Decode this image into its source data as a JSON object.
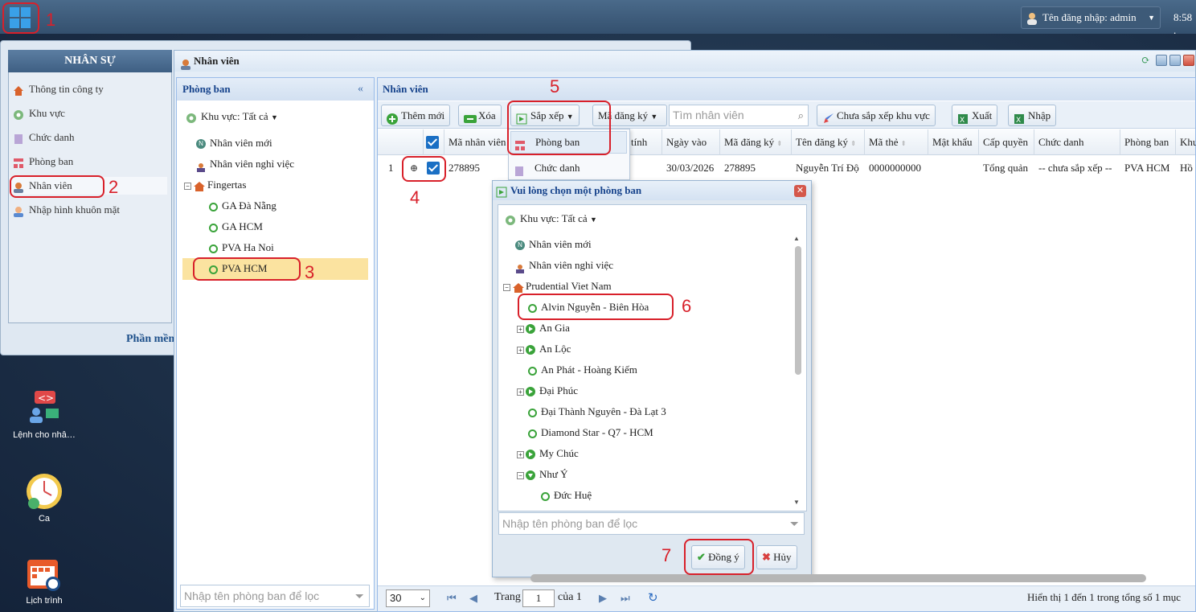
{
  "taskbar": {
    "user_label": "Tên đăng nhập: admin",
    "clock": "8:58 ."
  },
  "start_menu": {
    "title": "NHÂN SỰ",
    "items": [
      "Thông tin công ty",
      "Khu vực",
      "Chức danh",
      "Phòng ban",
      "Nhân viên",
      "Nhập hình khuôn mặt"
    ],
    "footer": "Phần mềm"
  },
  "desktop": {
    "icons": [
      "Lệnh cho nhâ…",
      "Ca",
      "Lịch trình"
    ]
  },
  "window": {
    "title": "Nhân viên"
  },
  "phong_ban": {
    "header": "Phòng ban",
    "region_filter": "Khu vực: Tất cả",
    "tree": [
      "Nhân viên mới",
      "Nhân viên nghỉ việc",
      "Fingertas",
      "GA Đà Nẵng",
      "GA HCM",
      "PVA Ha Noi",
      "PVA HCM"
    ],
    "filter_placeholder": "Nhập tên phòng ban để lọc"
  },
  "nhan_vien": {
    "header": "Nhân viên",
    "toolbar": {
      "add": "Thêm mới",
      "delete": "Xóa",
      "sort": "Sắp xếp",
      "sort_field": "Mã đăng ký",
      "search_placeholder": "Tìm nhân viên",
      "unsorted": "Chưa sắp xếp khu vực",
      "export": "Xuất",
      "import": "Nhập"
    },
    "columns": [
      "Mã nhân viên",
      "tính",
      "Ngày vào",
      "Mã đăng ký",
      "Tên đăng ký",
      "Mã thẻ",
      "Mật khẩu",
      "Cấp quyền",
      "Chức danh",
      "Phòng ban",
      "Khu"
    ],
    "rows": [
      {
        "index": "1",
        "ma_nv": "278895",
        "ngay_vao": "30/03/2026",
        "ma_dk": "278895",
        "ten_dk": "Nguyễn Trí Độ",
        "ma_the": "0000000000",
        "mat_khau": "",
        "cap_quyen": "Tổng quản",
        "chuc_danh": "-- chưa sắp xếp --",
        "phong_ban": "PVA HCM",
        "khu": "Hồ"
      }
    ],
    "sort_menu": [
      "Phòng ban",
      "Chức danh"
    ],
    "footer": {
      "page_size": "30",
      "page_label": "Trang",
      "page": "1",
      "of": "của 1",
      "summary": "Hiển thị 1 đến 1 trong tổng số 1 mục"
    }
  },
  "dialog": {
    "title": "Vui lòng chọn một phòng ban",
    "region_filter": "Khu vực: Tất cả",
    "tree": [
      "Nhân viên mới",
      "Nhân viên nghỉ việc",
      "Prudential Viet Nam",
      "Alvin Nguyễn - Biên Hòa",
      "An Gia",
      "An Lộc",
      "An Phát - Hoàng Kiếm",
      "Đại Phúc",
      "Đại Thành Nguyên - Đà Lạt 3",
      "Diamond Star - Q7 - HCM",
      "My Chúc",
      "Như Ý",
      "Đức Huệ"
    ],
    "filter_placeholder": "Nhập tên phòng ban để lọc",
    "ok": "Đồng ý",
    "cancel": "Hủy"
  },
  "annotations": [
    "1",
    "2",
    "3",
    "4",
    "5",
    "6",
    "7"
  ],
  "colors": {
    "annotation": "#d8202a",
    "header_text": "#15428b",
    "tree_green": "#3aa33a",
    "checkbox": "#1a6fc4"
  }
}
